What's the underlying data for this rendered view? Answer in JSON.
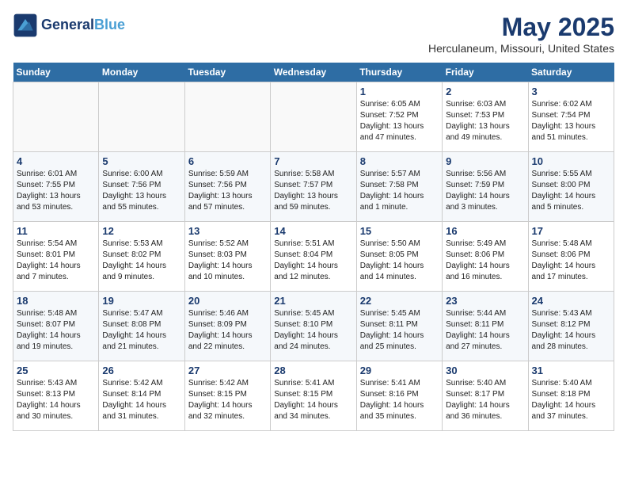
{
  "logo": {
    "line1": "General",
    "line2": "Blue"
  },
  "title": "May 2025",
  "location": "Herculaneum, Missouri, United States",
  "days_of_week": [
    "Sunday",
    "Monday",
    "Tuesday",
    "Wednesday",
    "Thursday",
    "Friday",
    "Saturday"
  ],
  "weeks": [
    [
      {
        "day": "",
        "info": ""
      },
      {
        "day": "",
        "info": ""
      },
      {
        "day": "",
        "info": ""
      },
      {
        "day": "",
        "info": ""
      },
      {
        "day": "1",
        "info": "Sunrise: 6:05 AM\nSunset: 7:52 PM\nDaylight: 13 hours\nand 47 minutes."
      },
      {
        "day": "2",
        "info": "Sunrise: 6:03 AM\nSunset: 7:53 PM\nDaylight: 13 hours\nand 49 minutes."
      },
      {
        "day": "3",
        "info": "Sunrise: 6:02 AM\nSunset: 7:54 PM\nDaylight: 13 hours\nand 51 minutes."
      }
    ],
    [
      {
        "day": "4",
        "info": "Sunrise: 6:01 AM\nSunset: 7:55 PM\nDaylight: 13 hours\nand 53 minutes."
      },
      {
        "day": "5",
        "info": "Sunrise: 6:00 AM\nSunset: 7:56 PM\nDaylight: 13 hours\nand 55 minutes."
      },
      {
        "day": "6",
        "info": "Sunrise: 5:59 AM\nSunset: 7:56 PM\nDaylight: 13 hours\nand 57 minutes."
      },
      {
        "day": "7",
        "info": "Sunrise: 5:58 AM\nSunset: 7:57 PM\nDaylight: 13 hours\nand 59 minutes."
      },
      {
        "day": "8",
        "info": "Sunrise: 5:57 AM\nSunset: 7:58 PM\nDaylight: 14 hours\nand 1 minute."
      },
      {
        "day": "9",
        "info": "Sunrise: 5:56 AM\nSunset: 7:59 PM\nDaylight: 14 hours\nand 3 minutes."
      },
      {
        "day": "10",
        "info": "Sunrise: 5:55 AM\nSunset: 8:00 PM\nDaylight: 14 hours\nand 5 minutes."
      }
    ],
    [
      {
        "day": "11",
        "info": "Sunrise: 5:54 AM\nSunset: 8:01 PM\nDaylight: 14 hours\nand 7 minutes."
      },
      {
        "day": "12",
        "info": "Sunrise: 5:53 AM\nSunset: 8:02 PM\nDaylight: 14 hours\nand 9 minutes."
      },
      {
        "day": "13",
        "info": "Sunrise: 5:52 AM\nSunset: 8:03 PM\nDaylight: 14 hours\nand 10 minutes."
      },
      {
        "day": "14",
        "info": "Sunrise: 5:51 AM\nSunset: 8:04 PM\nDaylight: 14 hours\nand 12 minutes."
      },
      {
        "day": "15",
        "info": "Sunrise: 5:50 AM\nSunset: 8:05 PM\nDaylight: 14 hours\nand 14 minutes."
      },
      {
        "day": "16",
        "info": "Sunrise: 5:49 AM\nSunset: 8:06 PM\nDaylight: 14 hours\nand 16 minutes."
      },
      {
        "day": "17",
        "info": "Sunrise: 5:48 AM\nSunset: 8:06 PM\nDaylight: 14 hours\nand 17 minutes."
      }
    ],
    [
      {
        "day": "18",
        "info": "Sunrise: 5:48 AM\nSunset: 8:07 PM\nDaylight: 14 hours\nand 19 minutes."
      },
      {
        "day": "19",
        "info": "Sunrise: 5:47 AM\nSunset: 8:08 PM\nDaylight: 14 hours\nand 21 minutes."
      },
      {
        "day": "20",
        "info": "Sunrise: 5:46 AM\nSunset: 8:09 PM\nDaylight: 14 hours\nand 22 minutes."
      },
      {
        "day": "21",
        "info": "Sunrise: 5:45 AM\nSunset: 8:10 PM\nDaylight: 14 hours\nand 24 minutes."
      },
      {
        "day": "22",
        "info": "Sunrise: 5:45 AM\nSunset: 8:11 PM\nDaylight: 14 hours\nand 25 minutes."
      },
      {
        "day": "23",
        "info": "Sunrise: 5:44 AM\nSunset: 8:11 PM\nDaylight: 14 hours\nand 27 minutes."
      },
      {
        "day": "24",
        "info": "Sunrise: 5:43 AM\nSunset: 8:12 PM\nDaylight: 14 hours\nand 28 minutes."
      }
    ],
    [
      {
        "day": "25",
        "info": "Sunrise: 5:43 AM\nSunset: 8:13 PM\nDaylight: 14 hours\nand 30 minutes."
      },
      {
        "day": "26",
        "info": "Sunrise: 5:42 AM\nSunset: 8:14 PM\nDaylight: 14 hours\nand 31 minutes."
      },
      {
        "day": "27",
        "info": "Sunrise: 5:42 AM\nSunset: 8:15 PM\nDaylight: 14 hours\nand 32 minutes."
      },
      {
        "day": "28",
        "info": "Sunrise: 5:41 AM\nSunset: 8:15 PM\nDaylight: 14 hours\nand 34 minutes."
      },
      {
        "day": "29",
        "info": "Sunrise: 5:41 AM\nSunset: 8:16 PM\nDaylight: 14 hours\nand 35 minutes."
      },
      {
        "day": "30",
        "info": "Sunrise: 5:40 AM\nSunset: 8:17 PM\nDaylight: 14 hours\nand 36 minutes."
      },
      {
        "day": "31",
        "info": "Sunrise: 5:40 AM\nSunset: 8:18 PM\nDaylight: 14 hours\nand 37 minutes."
      }
    ]
  ]
}
